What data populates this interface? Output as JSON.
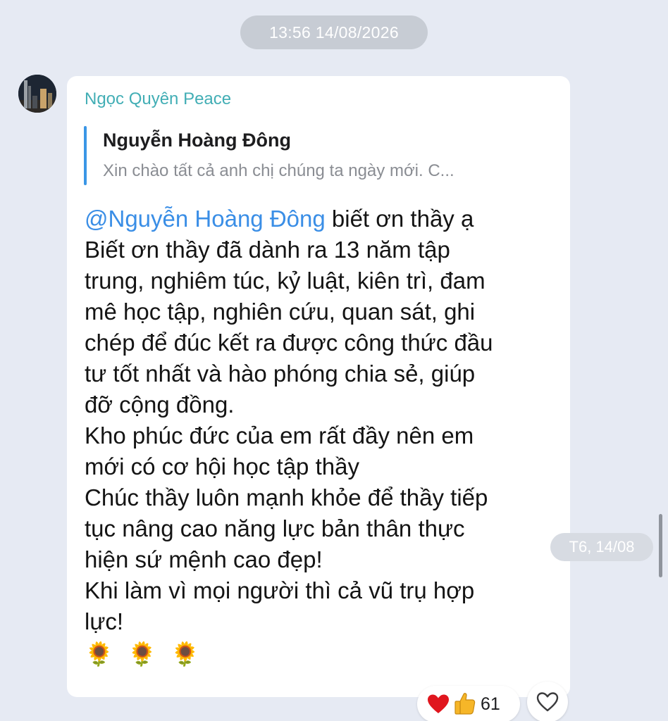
{
  "chat": {
    "date_divider": "13:56 14/08/2026",
    "message": {
      "sender_name": "Ngọc Quyên Peace",
      "quote": {
        "author": "Nguyễn Hoàng Đông",
        "snippet": "Xin chào tất cả anh chị chúng ta ngày mới. C..."
      },
      "mention": "@Nguyễn Hoàng Đông",
      "lines": [
        " biết ơn thầy ạ",
        "Biết ơn thầy đã dành ra 13 năm tập",
        "trung, nghiêm túc, kỷ luật, kiên trì, đam",
        "mê học tập, nghiên cứu, quan sát, ghi",
        "chép để đúc kết ra được công thức đầu",
        "tư tốt nhất và hào phóng chia sẻ, giúp",
        "đỡ cộng đồng.",
        "Kho phúc đức của em rất đầy nên em",
        "mới có cơ hội học tập thầy",
        "Chúc thầy luôn mạnh khỏe để thầy tiếp",
        "tục nâng cao năng lực bản thân thực",
        "hiện sứ mệnh cao đẹp!",
        "Khi làm vì mọi người thì cả vũ trụ hợp",
        "lực!"
      ],
      "emojis": [
        "🌻",
        "🌻",
        "🌻"
      ],
      "time_label": "T6, 14/08",
      "reactions": {
        "icons": [
          "red-heart-icon",
          "thumbs-up-icon"
        ],
        "count": "61"
      }
    }
  },
  "colors": {
    "background": "#e6eaf3",
    "sender_name": "#42aeb5",
    "mention": "#3a8ee6",
    "quote_bar": "#3a96e6",
    "pill": "#c7ccd4"
  }
}
